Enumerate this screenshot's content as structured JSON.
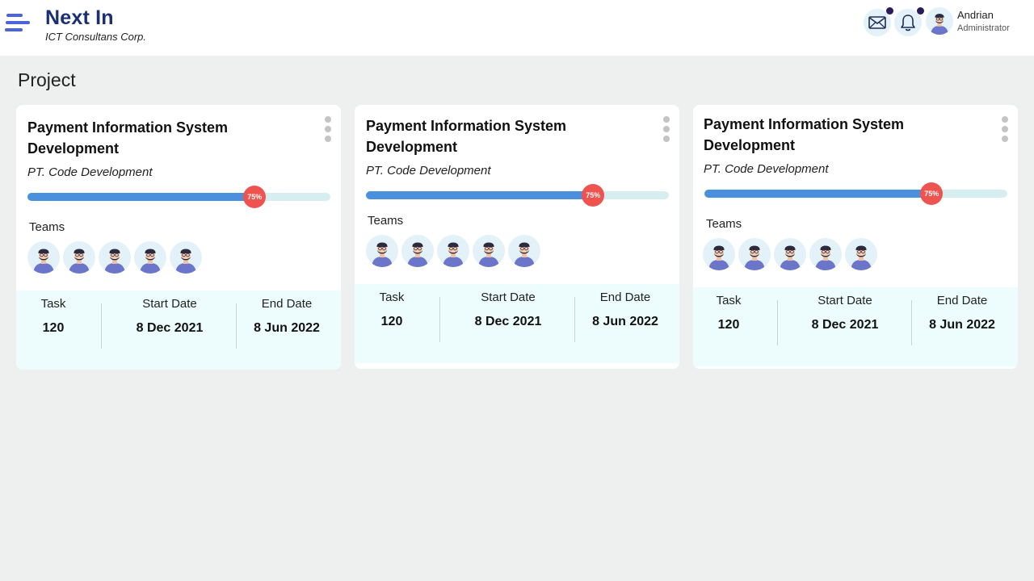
{
  "header": {
    "brand_title": "Next In",
    "brand_subtitle": "ICT Consultans Corp.",
    "user_name": "Andrian",
    "user_role": "Administrator"
  },
  "page_title": "Project",
  "colors": {
    "accent": "#4d63d8",
    "brand": "#1b2f74",
    "progress_fill": "#4a90dd",
    "progress_knob": "#ef5350",
    "stats_bg": "#edfcfc"
  },
  "projects": [
    {
      "title": "Payment Information System Development",
      "company": "PT. Code Development",
      "progress": 0.75,
      "progress_label": "75%",
      "teams_label": "Teams",
      "task_label": "Task",
      "task_value": "120",
      "start_label": "Start Date",
      "start_value": "8 Dec 2021",
      "end_label": "End Date",
      "end_value": "8 Jun 2022"
    },
    {
      "title": "Payment Information System Development",
      "company": "PT. Code Development",
      "progress": 0.75,
      "progress_label": "75%",
      "teams_label": "Teams",
      "task_label": "Task",
      "task_value": "120",
      "start_label": "Start Date",
      "start_value": "8 Dec 2021",
      "end_label": "End Date",
      "end_value": "8 Jun 2022"
    },
    {
      "title": "Payment Information System Development",
      "company": "PT. Code Development",
      "progress": 0.75,
      "progress_label": "75%",
      "teams_label": "Teams",
      "task_label": "Task",
      "task_value": "120",
      "start_label": "Start Date",
      "start_value": "8 Dec 2021",
      "end_label": "End Date",
      "end_value": "8 Jun 2022"
    }
  ]
}
